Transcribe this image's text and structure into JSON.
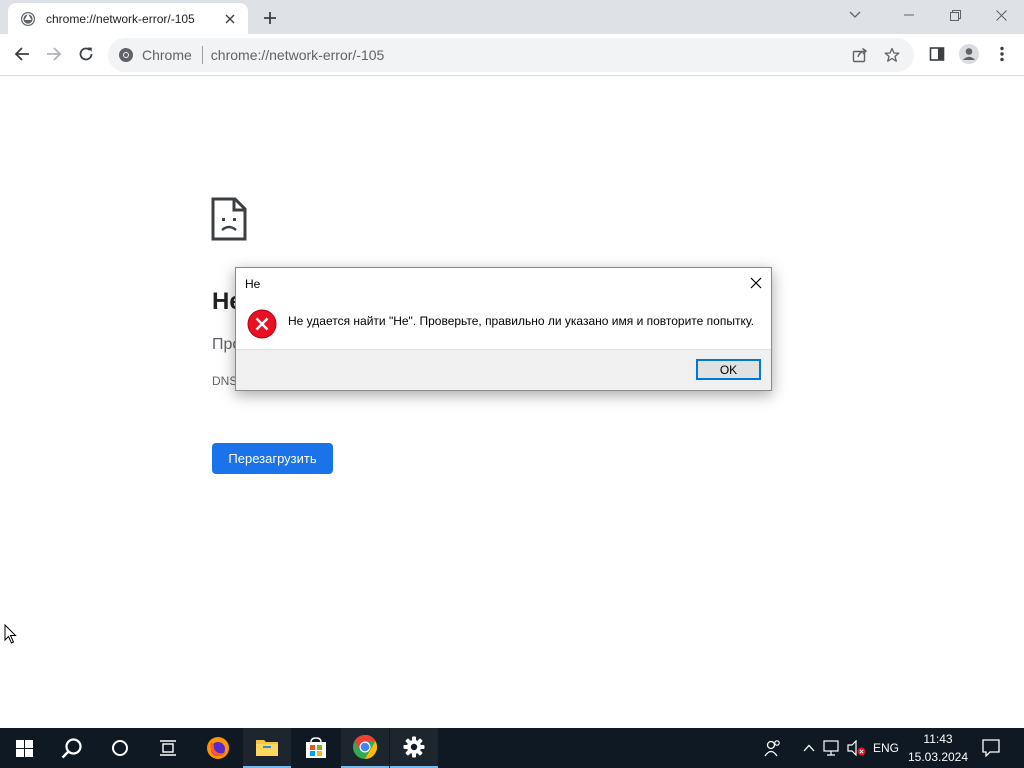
{
  "browser": {
    "tab": {
      "title": "chrome://network-error/-105"
    },
    "omnibox": {
      "chip_label": "Chrome",
      "url": "chrome://network-error/-105"
    }
  },
  "page": {
    "error_title": "He",
    "subtitle": "Про",
    "code": "DNS",
    "reload_label": "Перезагрузить"
  },
  "dialog": {
    "title": "He",
    "message": "Не удается найти \"Не\". Проверьте, правильно ли указано имя и повторите попытку.",
    "ok_label": "OK"
  },
  "taskbar": {
    "language": "ENG",
    "time": "11:43",
    "date": "15.03.2024"
  },
  "colors": {
    "accent": "#1a73e8",
    "taskbar_bg": "#0f1923",
    "error_red": "#e81123"
  }
}
